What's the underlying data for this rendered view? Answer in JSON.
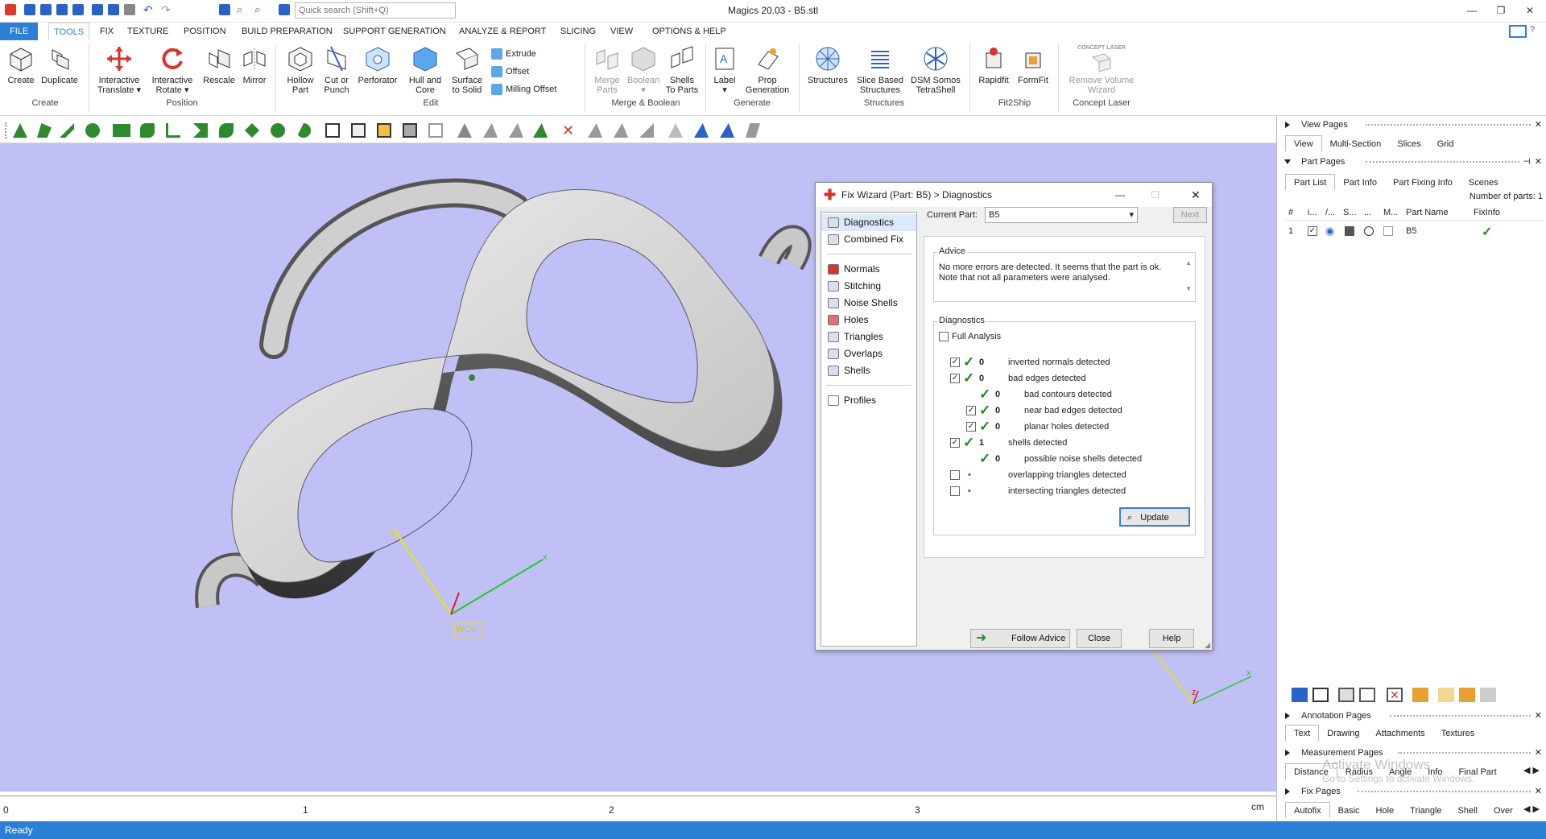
{
  "window": {
    "title": "Magics 20.03 - B5.stl"
  },
  "search": {
    "placeholder": "Quick search (Shift+Q)"
  },
  "menu": [
    "FILE",
    "TOOLS",
    "FIX",
    "TEXTURE",
    "POSITION",
    "BUILD PREPARATION",
    "SUPPORT GENERATION",
    "ANALYZE & REPORT",
    "SLICING",
    "VIEW",
    "OPTIONS & HELP"
  ],
  "ribbon": {
    "create": "Create",
    "duplicate": "Duplicate",
    "grp_create": "Create",
    "itranslate1": "Interactive",
    "itranslate2": "Translate",
    "irotate1": "Interactive",
    "irotate2": "Rotate",
    "rescale": "Rescale",
    "mirror": "Mirror",
    "grp_position": "Position",
    "hollow1": "Hollow",
    "hollow2": "Part",
    "cut1": "Cut or",
    "cut2": "Punch",
    "perforator": "Perforator",
    "hull1": "Hull and",
    "hull2": "Core",
    "surface1": "Surface",
    "surface2": "to Solid",
    "extrude": "Extrude",
    "offset": "Offset",
    "milling": "Milling Offset",
    "grp_edit": "Edit",
    "merge1": "Merge",
    "merge2": "Parts",
    "boolean": "Boolean",
    "shells1": "Shells",
    "shells2": "To Parts",
    "grp_merge": "Merge & Boolean",
    "label": "Label",
    "prop1": "Prop",
    "prop2": "Generation",
    "grp_generate": "Generate",
    "structures": "Structures",
    "slice1": "Slice Based",
    "slice2": "Structures",
    "dsm1": "DSM Somos",
    "dsm2": "TetraShell",
    "grp_structures": "Structures",
    "rapidfit": "Rapidfit",
    "formfit": "FormFit",
    "grp_fit": "Fit2Ship",
    "concept_logo": "CONCEPT LASER",
    "remove1": "Remove Volume",
    "remove2": "Wizard",
    "grp_concept": "Concept Laser"
  },
  "viewport": {
    "wcs": "WCS",
    "axis_x": "x",
    "axis_y": "y",
    "axis_z": "z"
  },
  "ruler": {
    "ticks": [
      "0",
      "1",
      "2",
      "3"
    ],
    "unit": "cm"
  },
  "status": "Ready",
  "right": {
    "view_pages": "View Pages",
    "view_tabs": [
      "View",
      "Multi-Section",
      "Slices",
      "Grid"
    ],
    "part_pages": "Part Pages",
    "part_tabs": [
      "Part List",
      "Part Info",
      "Part Fixing Info",
      "Scenes"
    ],
    "nparts": "Number of parts: 1",
    "cols": [
      "#",
      "i...",
      "/...",
      "S...",
      "...",
      "M...",
      "Part Name",
      "FixInfo"
    ],
    "row": {
      "num": "1",
      "name": "B5"
    },
    "annotation_pages": "Annotation Pages",
    "annotation_tabs": [
      "Text",
      "Drawing",
      "Attachments",
      "Textures"
    ],
    "measurement_pages": "Measurement Pages",
    "measurement_tabs": [
      "Distance",
      "Radius",
      "Angle",
      "Info",
      "Final Part"
    ],
    "fix_pages": "Fix Pages",
    "fix_tabs": [
      "Autofix",
      "Basic",
      "Hole",
      "Triangle",
      "Shell",
      "Over"
    ],
    "watermark1": "Activate Windows",
    "watermark2": "Go to Settings to activate Windows."
  },
  "dialog": {
    "title": "Fix Wizard (Part: B5) > Diagnostics",
    "nav1": [
      "Diagnostics",
      "Combined Fix"
    ],
    "nav2": [
      "Normals",
      "Stitching",
      "Noise Shells",
      "Holes",
      "Triangles",
      "Overlaps",
      "Shells"
    ],
    "nav3": [
      "Profiles"
    ],
    "current_part_label": "Current Part:",
    "current_part": "B5",
    "next": "Next",
    "advice_label": "Advice",
    "advice": "No more errors are detected. It seems that the part is ok. Note that not all parameters were analysed.",
    "diag_label": "Diagnostics",
    "full_analysis": "Full Analysis",
    "rows": [
      {
        "n": "0",
        "t": "inverted normals detected"
      },
      {
        "n": "0",
        "t": "bad edges detected"
      },
      {
        "n": "0",
        "t": "bad contours detected"
      },
      {
        "n": "0",
        "t": "near bad edges detected"
      },
      {
        "n": "0",
        "t": "planar holes detected"
      },
      {
        "n": "1",
        "t": "shells detected"
      },
      {
        "n": "0",
        "t": "possible noise shells detected"
      },
      {
        "n": "",
        "t": "overlapping triangles detected"
      },
      {
        "n": "",
        "t": "intersecting triangles detected"
      }
    ],
    "update": "Update",
    "follow": "Follow Advice",
    "close": "Close",
    "help": "Help"
  }
}
